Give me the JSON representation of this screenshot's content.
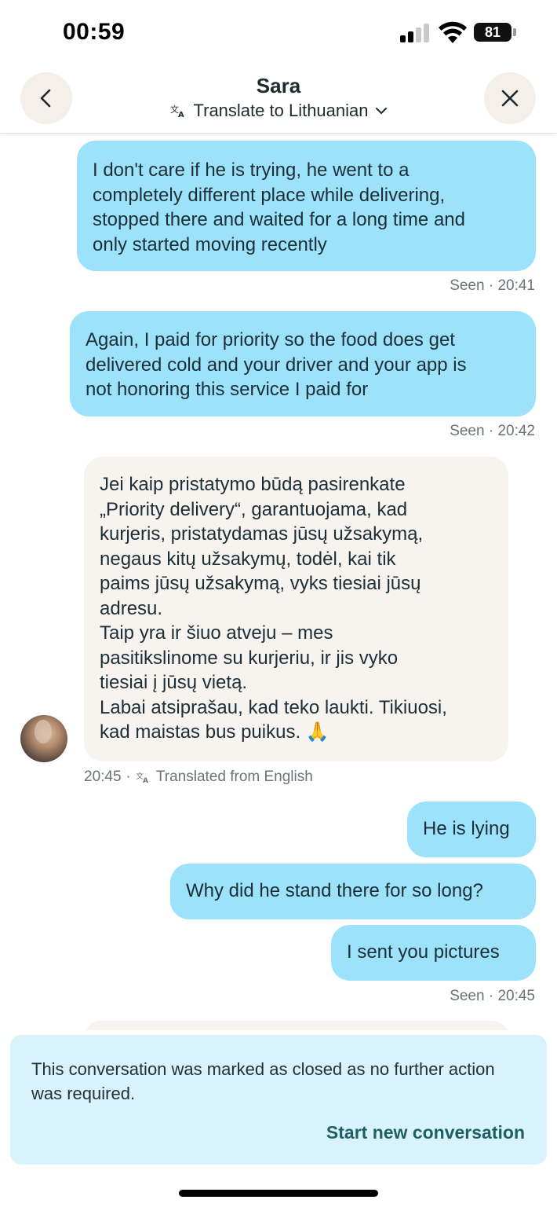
{
  "status_bar": {
    "time": "00:59",
    "battery": "81"
  },
  "header": {
    "title": "Sara",
    "translate_label": "Translate to Lithuanian",
    "back_icon": "chevron-left-icon",
    "close_icon": "close-icon"
  },
  "messages": [
    {
      "direction": "outgoing",
      "lines": [
        "I don't care if he is trying, he went to a",
        "completely different place while delivering,",
        "stopped there and waited for a long time and",
        "only started moving recently"
      ],
      "meta": "Seen · 20:41"
    },
    {
      "direction": "outgoing",
      "lines": [
        "Again, I paid for priority so the food does get",
        "delivered cold and your driver and your app is",
        "not honoring this service I paid for"
      ],
      "meta": "Seen · 20:42"
    },
    {
      "direction": "incoming",
      "lines": [
        "Jei kaip pristatymo būdą pasirenkate",
        "„Priority delivery“, garantuojama, kad",
        "kurjeris, pristatydamas jūsų užsakymą,",
        "negaus kitų užsakymų, todėl, kai tik",
        "paims jūsų užsakymą, vyks tiesiai jūsų",
        "adresu.",
        "Taip yra ir šiuo atveju – mes",
        "pasitikslinome su kurjeriu, ir jis vyko",
        "tiesiai į jūsų vietą.",
        "Labai atsiprašau, kad teko laukti. Tikiuosi,",
        "kad maistas bus puikus. 🙏"
      ],
      "meta_time": "20:45",
      "meta_translated": "Translated from English"
    },
    {
      "direction": "outgoing",
      "text": "He is lying"
    },
    {
      "direction": "outgoing",
      "text": "Why did he stand there for so long?"
    },
    {
      "direction": "outgoing",
      "text": "I sent you pictures",
      "meta": "Seen · 20:45"
    }
  ],
  "banner": {
    "text": "This conversation was marked as closed as no further action was required.",
    "link": "Start new conversation"
  },
  "colors": {
    "outgoing_bubble": "#9ce2fa",
    "incoming_bubble": "#f7f3ef",
    "banner_bg": "#d8f3fb",
    "link": "#1d5e67"
  }
}
